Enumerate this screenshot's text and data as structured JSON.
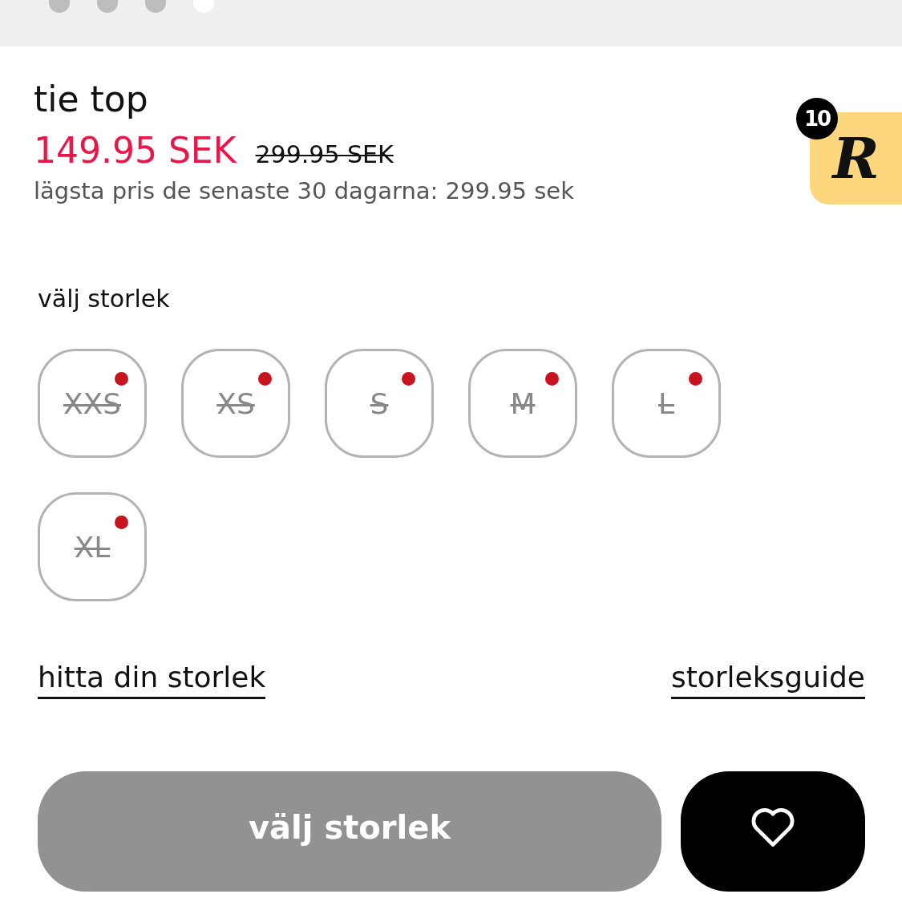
{
  "carousel_dots": [
    {
      "selected": false
    },
    {
      "selected": false
    },
    {
      "selected": false
    },
    {
      "selected": true
    }
  ],
  "product": {
    "title": "tie top",
    "price": "149.95 SEK",
    "old_price": "299.95 SEK",
    "lowest_price_note": "lägsta pris de senaste 30 dagarna: 299.95 sek"
  },
  "badge": {
    "count": "10",
    "logo_letter": "R"
  },
  "size_label": "välj storlek",
  "sizes": [
    {
      "label": "XXS",
      "available": false
    },
    {
      "label": "XS",
      "available": false
    },
    {
      "label": "S",
      "available": false
    },
    {
      "label": "M",
      "available": false
    },
    {
      "label": "L",
      "available": false
    },
    {
      "label": "XL",
      "available": false
    }
  ],
  "links": [
    "hitta din storlek",
    "storleksguide"
  ],
  "add_button": {
    "label": "välj storlek",
    "disabled": true
  }
}
